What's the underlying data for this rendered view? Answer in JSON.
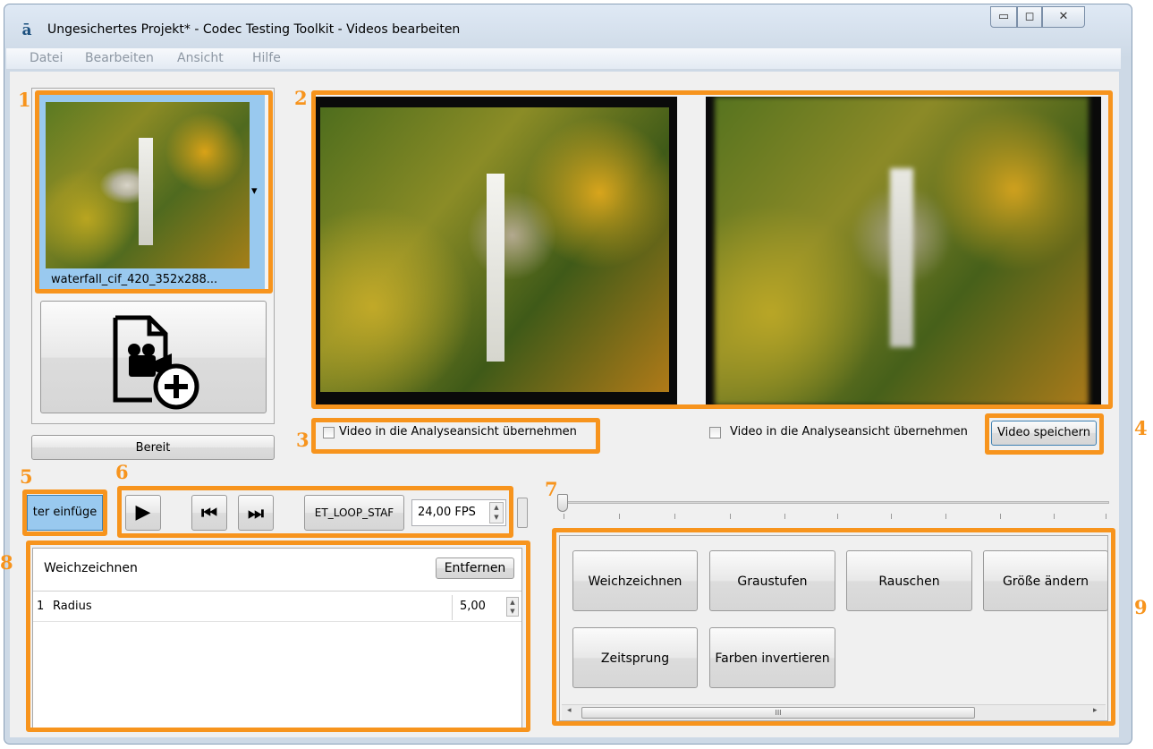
{
  "window": {
    "title": "Ungesichertes Projekt* - Codec Testing Toolkit - Videos bearbeiten",
    "minimize_glyph": "▭",
    "maximize_glyph": "◻",
    "close_glyph": "✕"
  },
  "menu": {
    "items": [
      "Datei",
      "Bearbeiten",
      "Ansicht",
      "Hilfe"
    ]
  },
  "video_list": {
    "selected_label": "waterfall_cif_420_352x288...",
    "dropdown_glyph": "▾",
    "status_button": "Bereit"
  },
  "preview": {
    "left_checkbox_label": "Video in die Analyseansicht übernehmen",
    "right_checkbox_label": "Video in die Analyseansicht übernehmen",
    "save_button": "Video speichern"
  },
  "toolbar": {
    "insert_filter_label": "ter einfüge",
    "play_glyph": "▶",
    "prev_glyph": "⏮",
    "next_glyph": "⏭",
    "loop_button": "ET_LOOP_STAF",
    "fps_value": "24,00 FPS"
  },
  "timeline": {
    "position": 0
  },
  "filter_editor": {
    "filter_name": "Weichzeichnen",
    "remove_button": "Entfernen",
    "rows": [
      {
        "index": "1",
        "param": "Radius",
        "value": "5,00"
      }
    ]
  },
  "filter_palette": {
    "buttons": [
      "Weichzeichnen",
      "Graustufen",
      "Rauschen",
      "Größe ändern",
      "Zeitsprung",
      "Farben invertieren"
    ],
    "scroll_glyph": "III"
  },
  "callouts": [
    "1",
    "2",
    "3",
    "4",
    "5",
    "6",
    "7",
    "8",
    "9"
  ],
  "colors": {
    "highlight": "#f7941d",
    "selection": "#99c9ef",
    "window_frame": "#cdd9e6"
  }
}
